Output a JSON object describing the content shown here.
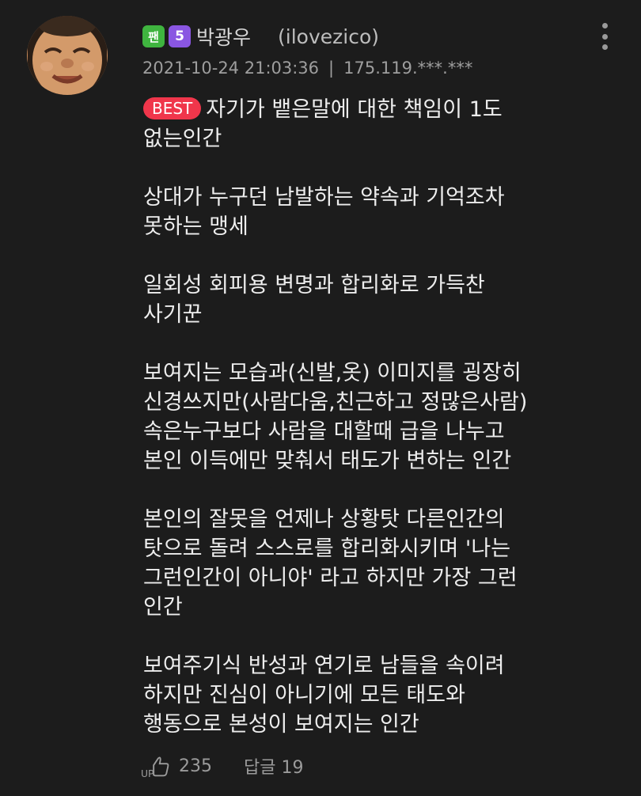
{
  "user": {
    "badge_fan": "팬",
    "badge_level": "5",
    "nickname": "박광우",
    "user_id": "(ilovezico)"
  },
  "meta": {
    "datetime": "2021-10-24 21:03:36",
    "separator": "|",
    "ip": "175.119.***.***"
  },
  "best_label": "BEST",
  "paragraphs": [
    [
      "자기가 뱉은말에 대한 책임이 1도",
      "없는인간"
    ],
    [
      "상대가 누구던 남발하는 약속과 기억조차",
      "못하는 맹세"
    ],
    [
      "일회성 회피용 변명과 합리화로 가득찬",
      "사기꾼"
    ],
    [
      "보여지는 모습과(신발,옷) 이미지를 굉장히",
      "신경쓰지만(사람다움,친근하고 정많은사람)",
      "속은누구보다 사람을 대할때 급을 나누고",
      "본인 이득에만 맞춰서 태도가 변하는 인간"
    ],
    [
      "본인의 잘못을 언제나 상황탓 다른인간의",
      "탓으로 돌려 스스로를 합리화시키며 '나는",
      "그런인간이 아니야' 라고 하지만 가장 그런",
      "인간"
    ],
    [
      "보여주기식 반성과 연기로 남들을 속이려",
      "하지만 진심이 아니기에 모든 태도와",
      "행동으로 본성이 보여지는 인간"
    ]
  ],
  "footer": {
    "up_icon": "thumbs-up-icon",
    "up_count": "235",
    "reply_label": "답글 19"
  },
  "colors": {
    "background": "#1c1c1c",
    "best_badge": "#f0364b",
    "fan_badge": "#3fb43f",
    "level_badge": "#8a56e2"
  }
}
